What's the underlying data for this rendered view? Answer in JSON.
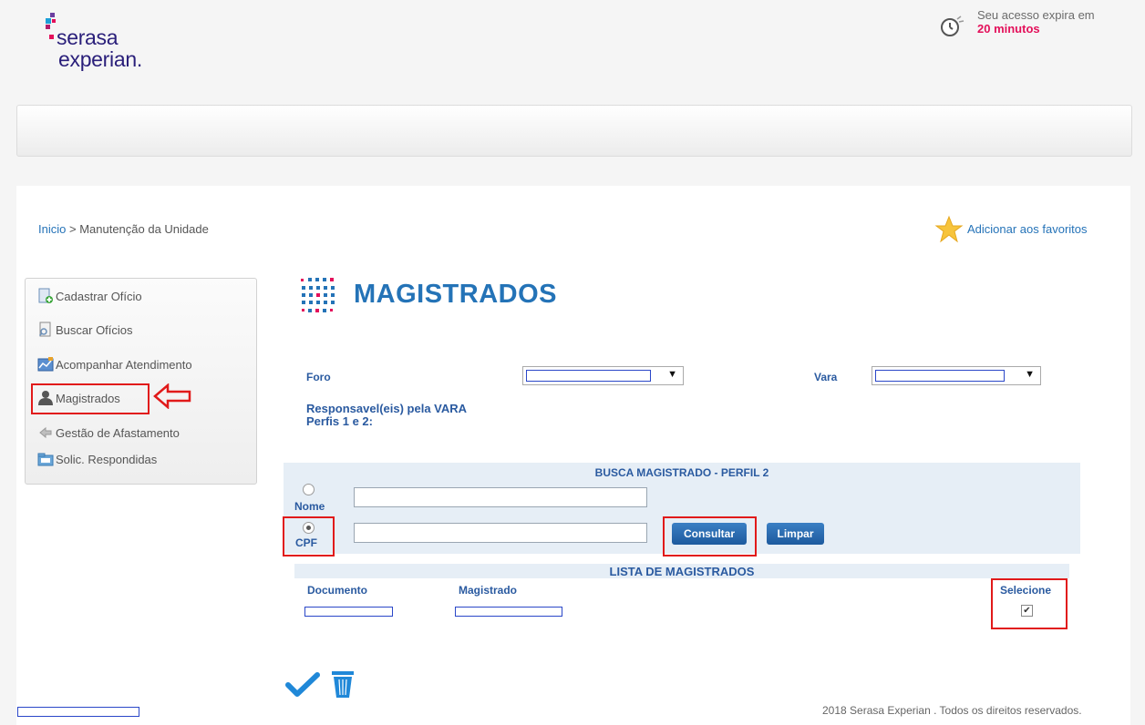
{
  "brand": {
    "line1": "serasa",
    "line2": "experian."
  },
  "session": {
    "line1": "Seu acesso expira em",
    "line2": "20 minutos"
  },
  "breadcrumb": {
    "home": "Inicio",
    "separator": " > ",
    "current": "Manutenção da Unidade"
  },
  "favorites": {
    "label": "Adicionar aos favoritos"
  },
  "sidebar": {
    "items": [
      {
        "label": "Cadastrar Ofício",
        "icon": "add-document-icon"
      },
      {
        "label": "Buscar Ofícios",
        "icon": "search-document-icon"
      },
      {
        "label": "Acompanhar Atendimento",
        "icon": "chart-icon"
      },
      {
        "label": "Magistrados",
        "icon": "user-icon"
      },
      {
        "label": "Gestão de Afastamento",
        "icon": "arrow-left-icon"
      },
      {
        "label": "Solic. Respondidas",
        "icon": "folder-icon"
      }
    ]
  },
  "page": {
    "title": "MAGISTRADOS"
  },
  "filters": {
    "foro_label": "Foro",
    "vara_label": "Vara",
    "responsaveis_line1": "Responsavel(eis) pela VARA",
    "responsaveis_line2": "Perfis 1 e 2:"
  },
  "search": {
    "title": "BUSCA MAGISTRADO - PERFIL 2",
    "nome_label": "Nome",
    "cpf_label": "CPF",
    "nome_value": "",
    "cpf_value": "",
    "consultar_label": "Consultar",
    "limpar_label": "Limpar",
    "selected": "CPF"
  },
  "list": {
    "title": "LISTA DE MAGISTRADOS",
    "columns": [
      "Documento",
      "Magistrado",
      "Selecione"
    ],
    "rows": [
      {
        "selected": true
      }
    ]
  },
  "footer": {
    "copyright": "2018 Serasa Experian . Todos os direitos reservados."
  },
  "colors": {
    "accent": "#2473b7",
    "label": "#2a5aa0",
    "alert": "#e3105a",
    "highlight": "#e11a1a"
  }
}
